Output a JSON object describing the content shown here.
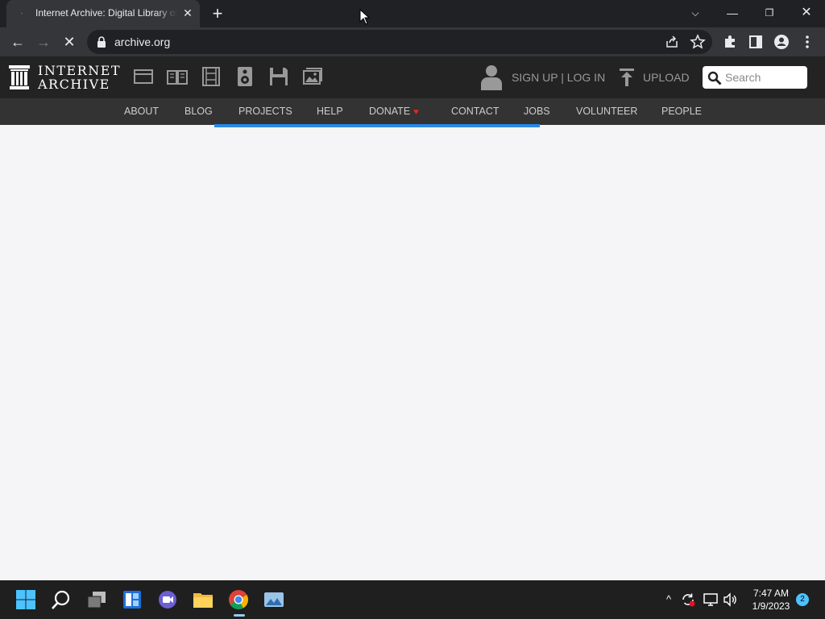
{
  "browser": {
    "tab": {
      "favicon": "·",
      "title": "Internet Archive: Digital Library of Free & Borrowable Books, Movies, Music & Wayback Machine",
      "close_glyph": "✕"
    },
    "new_tab_glyph": "+",
    "window_controls": {
      "tab_search": "⌵",
      "minimize": "—",
      "restore": "❐",
      "close": "✕"
    },
    "nav": {
      "back": "←",
      "forward": "→",
      "stop": "✕"
    },
    "address": {
      "url": "archive.org"
    },
    "icons": [
      "lock-icon",
      "share-icon",
      "star-icon",
      "extensions-icon",
      "side-panel-icon",
      "profile-icon",
      "menu-icon"
    ]
  },
  "site": {
    "logo_text_line1": "INTERNET",
    "logo_text_line2": "ARCHIVE",
    "media_icons": [
      "web-icon",
      "texts-icon",
      "video-icon",
      "audio-icon",
      "software-icon",
      "images-icon"
    ],
    "signup": "SIGN UP | LOG IN",
    "upload": "UPLOAD",
    "search": {
      "placeholder": "Search",
      "value": ""
    },
    "nav": [
      {
        "label": "ABOUT"
      },
      {
        "label": "BLOG"
      },
      {
        "label": "PROJECTS"
      },
      {
        "label": "HELP"
      },
      {
        "label": "DONATE",
        "icon": "♥"
      },
      {
        "label": "CONTACT"
      },
      {
        "label": "JOBS"
      },
      {
        "label": "VOLUNTEER"
      },
      {
        "label": "PEOPLE"
      }
    ],
    "colors": {
      "header_bg": "#232323",
      "nav_bg": "#333333",
      "progress": "#2a88e6",
      "heart": "#ee2222"
    }
  },
  "taskbar": {
    "apps": [
      "start-icon",
      "search-icon",
      "task-view-icon",
      "widgets-icon",
      "teams-chat-icon",
      "file-explorer-icon",
      "chrome-icon",
      "photos-icon"
    ],
    "tray": {
      "chevron": "^",
      "sync": "⟳",
      "network": "▭",
      "volume": "🔈"
    },
    "time": "7:47 AM",
    "date": "1/9/2023",
    "notification_count": "2"
  }
}
